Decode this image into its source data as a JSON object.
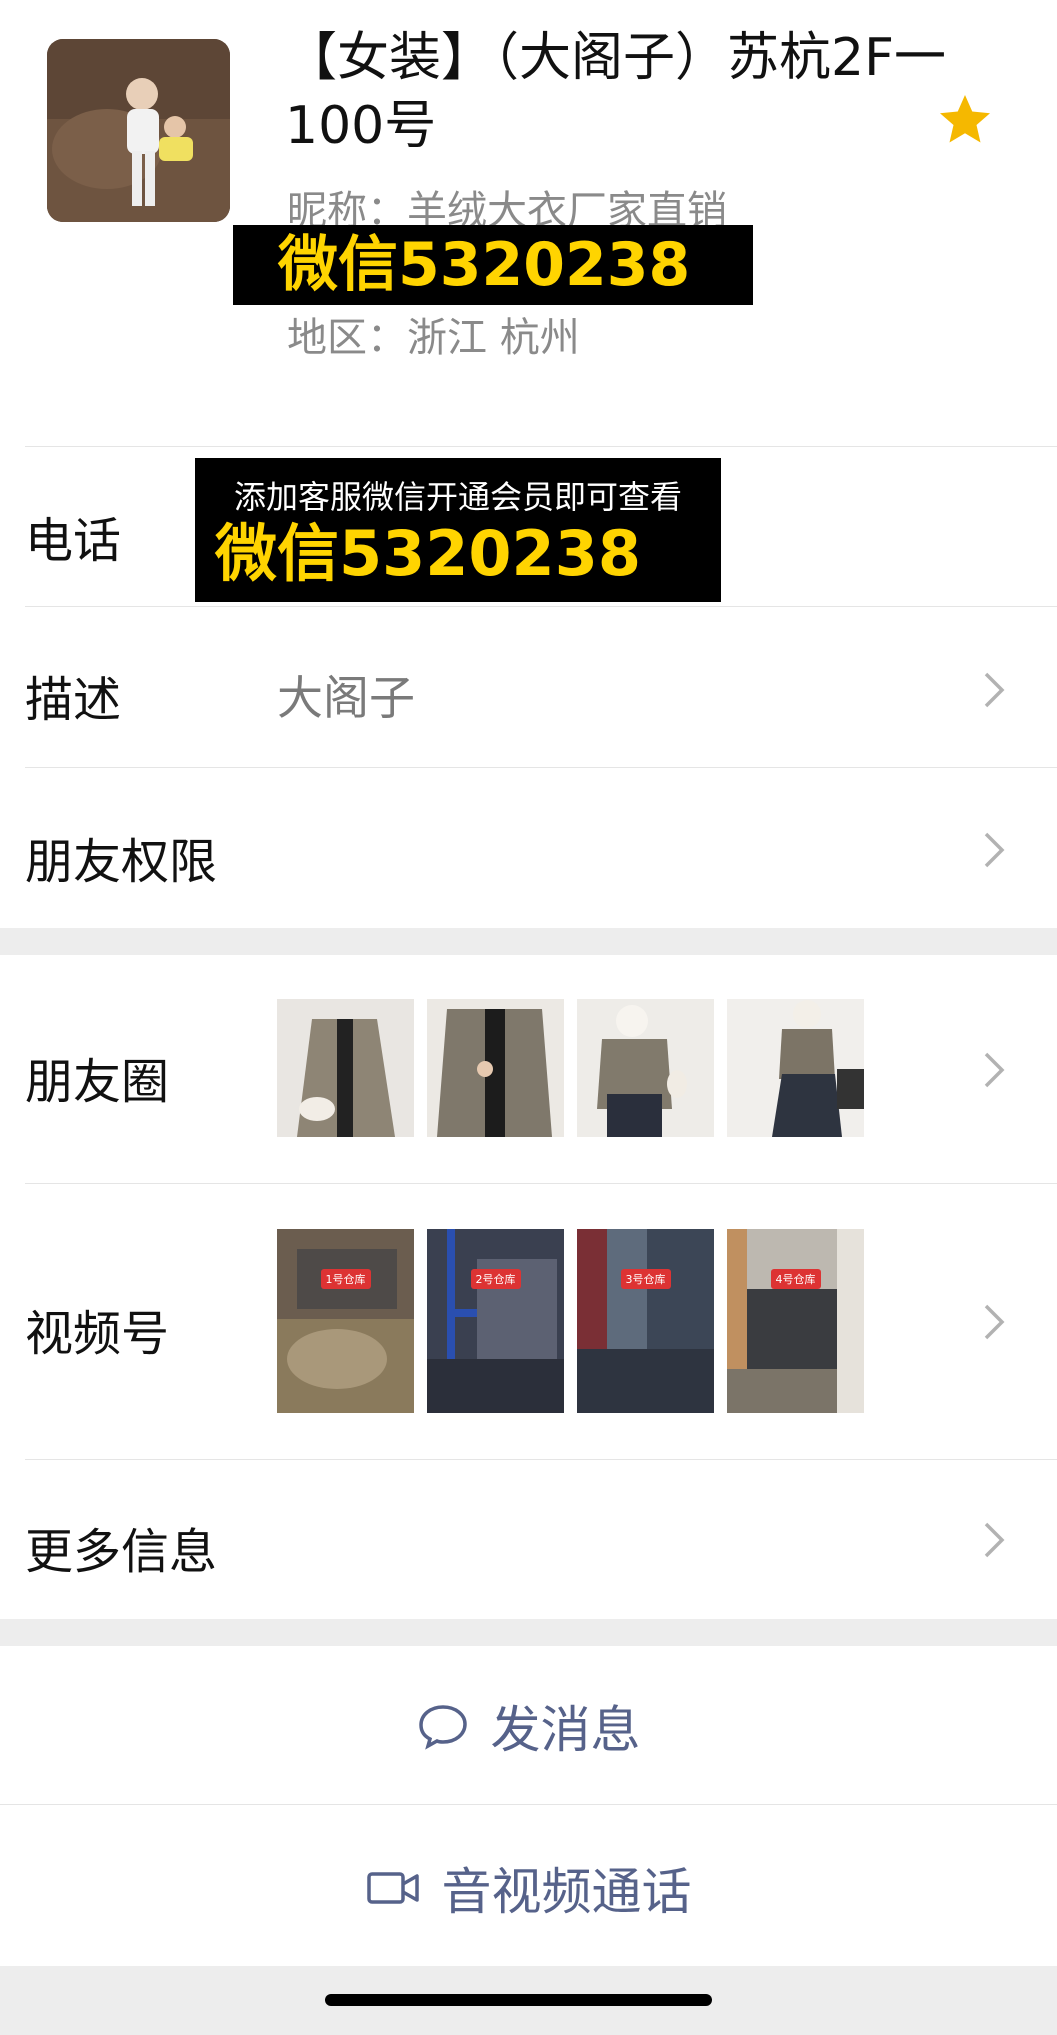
{
  "profile": {
    "title": "【女装】（大阁子）苏杭2F一100号",
    "nickname": "昵称：羊绒大衣厂家直销",
    "region": "地区：浙江 杭州",
    "overlay_wechat": "微信5320238"
  },
  "phone": {
    "label": "电话",
    "overlay_line1": "添加客服微信开通会员即可查看",
    "overlay_line2": "微信5320238"
  },
  "description": {
    "label": "描述",
    "value": "大阁子"
  },
  "friend_permission": {
    "label": "朋友权限"
  },
  "moments": {
    "label": "朋友圈"
  },
  "channels": {
    "label": "视频号",
    "tags": [
      "1号仓库",
      "2号仓库",
      "3号仓库",
      "4号仓库"
    ]
  },
  "more_info": {
    "label": "更多信息"
  },
  "actions": {
    "message": "发消息",
    "call": "音视频通话"
  },
  "colors": {
    "star": "#f5b800",
    "overlay_text": "#ffd400",
    "action_text": "#56628a",
    "gap": "#ededed"
  },
  "icons": [
    "star-icon",
    "chevron-right-icon",
    "chat-bubble-icon",
    "video-camera-icon"
  ]
}
